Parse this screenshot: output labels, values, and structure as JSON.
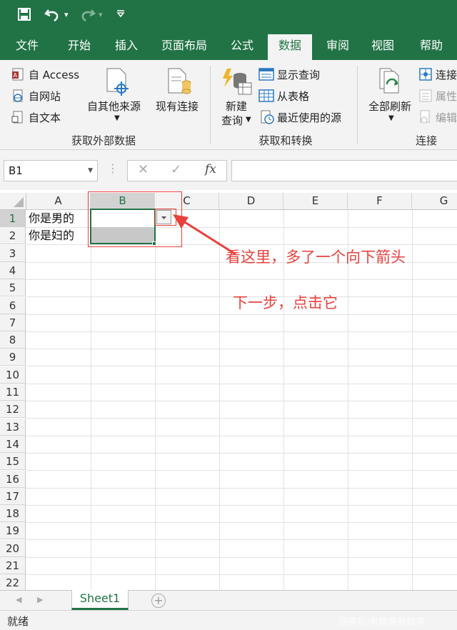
{
  "quick_access": {
    "save_icon": "save-icon",
    "undo_icon": "undo-icon",
    "redo_icon": "redo-icon",
    "customize_icon": "customize-icon",
    "dropdown": "▾"
  },
  "tabs": [
    {
      "label": "文件"
    },
    {
      "label": "开始"
    },
    {
      "label": "插入"
    },
    {
      "label": "页面布局"
    },
    {
      "label": "公式"
    },
    {
      "label": "数据"
    },
    {
      "label": "审阅"
    },
    {
      "label": "视图"
    },
    {
      "label": "帮助"
    }
  ],
  "ribbon": {
    "get_external": {
      "access": "自 Access",
      "web": "自网站",
      "text": "自文本",
      "other_sources": "自其他来源",
      "existing": "现有连接",
      "group_label": "获取外部数据"
    },
    "transform": {
      "new_query_line1": "新建",
      "new_query_line2": "查询",
      "show_queries": "显示查询",
      "from_table": "从表格",
      "recent_sources": "最近使用的源",
      "group_label": "获取和转换"
    },
    "connections": {
      "refresh_all": "全部刷新",
      "connections": "连接",
      "properties": "属性",
      "edit_links": "编辑",
      "group_label": "连接"
    }
  },
  "formula_bar": {
    "name_box": "B1",
    "cancel": "✕",
    "enter": "✓",
    "fx": "fx",
    "value": ""
  },
  "columns": [
    "A",
    "B",
    "C",
    "D",
    "E",
    "F",
    "G"
  ],
  "selected_column": "B",
  "rows": [
    "1",
    "2",
    "3",
    "4",
    "5",
    "6",
    "7",
    "8",
    "9",
    "10",
    "11",
    "12",
    "13",
    "14",
    "15",
    "16",
    "17",
    "18",
    "19",
    "20",
    "21",
    "22"
  ],
  "cells": {
    "A1": "你是男的",
    "A2": "你是妇的",
    "B1": "",
    "B2": ""
  },
  "sheet_tabs": [
    {
      "label": "Sheet1"
    }
  ],
  "status": {
    "ready": "就绪"
  },
  "watermark": "百家号/有趣哥有奴率",
  "annotations": {
    "line1": "看这里，多了一个向下箭头",
    "line2": "下一步，点击它"
  },
  "colors": {
    "excel_green": "#217346",
    "annotation_red": "#e8413c"
  }
}
